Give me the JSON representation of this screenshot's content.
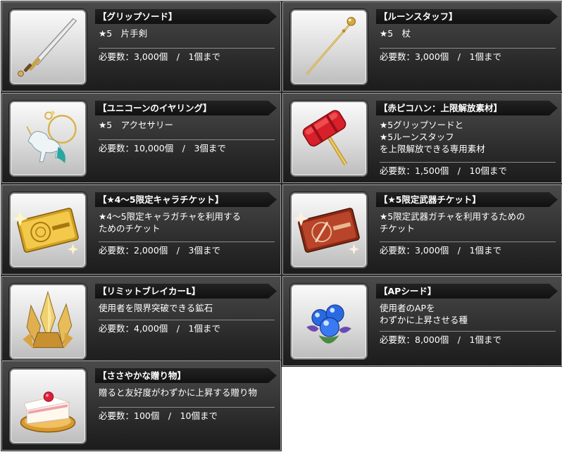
{
  "items": [
    {
      "icon": "sword-icon",
      "title": "【グリップソード】",
      "desc": [
        "★5　片手剣"
      ],
      "req": "必要数：3,000個　/　1個まで"
    },
    {
      "icon": "staff-icon",
      "title": "【ルーンスタッフ】",
      "desc": [
        "★5　杖"
      ],
      "req": "必要数：3,000個　/　1個まで"
    },
    {
      "icon": "unicorn-earring-icon",
      "title": "【ユニコーンのイヤリング】",
      "desc": [
        "★5　アクセサリー"
      ],
      "req": "必要数：10,000個　/　3個まで"
    },
    {
      "icon": "red-hammer-icon",
      "title": "【赤ピコハン：上限解放素材】",
      "desc": [
        "★5グリップソードと",
        "★5ルーンスタッフ",
        "を上限解放できる専用素材"
      ],
      "req": "必要数：1,500個　/　10個まで"
    },
    {
      "icon": "gold-ticket-icon",
      "title": "【★4～5限定キャラチケット】",
      "desc": [
        "★4～5限定キャラガチャを利用する",
        "ためのチケット"
      ],
      "req": "必要数：2,000個　/　3個まで"
    },
    {
      "icon": "weapon-ticket-icon",
      "title": "【★5限定武器チケット】",
      "desc": [
        "★5限定武器ガチャを利用するための",
        "チケット"
      ],
      "req": "必要数：3,000個　/　1個まで"
    },
    {
      "icon": "crystal-icon",
      "title": "【リミットブレイカーL】",
      "desc": [
        "使用者を限界突破できる鉱石"
      ],
      "req": "必要数：4,000個　/　1個まで"
    },
    {
      "icon": "ap-seed-icon",
      "title": "【APシード】",
      "desc": [
        "使用者のAPを",
        "わずかに上昇させる種"
      ],
      "req": "必要数：8,000個　/　1個まで"
    },
    {
      "icon": "cake-icon",
      "title": "【ささやかな贈り物】",
      "desc": [
        "贈ると友好度がわずかに上昇する贈り物"
      ],
      "req": "必要数：100個　/　10個まで"
    }
  ]
}
